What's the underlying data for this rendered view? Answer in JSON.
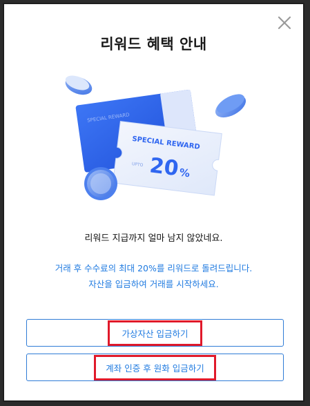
{
  "modal": {
    "title": "리워드 혜택 안내",
    "close_icon": "close-icon"
  },
  "illustration": {
    "back_ticket_text": "SPECIAL REWARD",
    "front_ticket_title": "SPECIAL REWARD",
    "front_ticket_prefix": "UPTO",
    "front_ticket_value": "20",
    "front_ticket_unit": "%",
    "colors": {
      "back_ticket": "#2f66f0",
      "front_ticket": "#e7eefc",
      "coin": "#5b8ff0"
    }
  },
  "message": "리워드 지급까지 얼마 남지 않았네요.",
  "note": {
    "line1": "거래 후 수수료의 최대 20%를 리워드로 돌려드립니다.",
    "line2": "자산을 입금하여 거래를 시작하세요."
  },
  "buttons": {
    "deposit_crypto": "가상자산 입금하기",
    "deposit_krw": "계좌 인증 후 원화 입금하기"
  }
}
